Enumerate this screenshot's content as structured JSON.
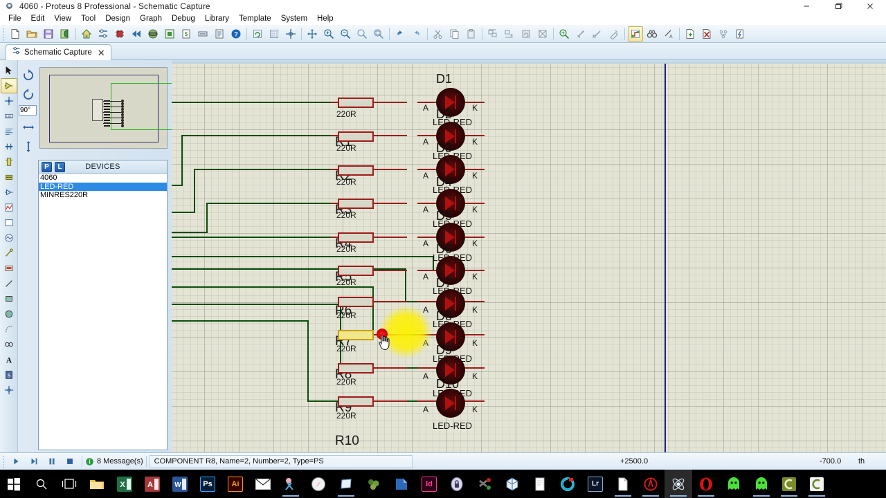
{
  "window": {
    "title": "4060 - Proteus 8 Professional - Schematic Capture",
    "app_icon": "proteus-icon",
    "minimize_label": "—",
    "maximize_label": "❐",
    "close_label": "✕"
  },
  "menubar": {
    "items": [
      {
        "label": "File"
      },
      {
        "label": "Edit"
      },
      {
        "label": "View"
      },
      {
        "label": "Tool"
      },
      {
        "label": "Design"
      },
      {
        "label": "Graph"
      },
      {
        "label": "Debug"
      },
      {
        "label": "Library"
      },
      {
        "label": "Template"
      },
      {
        "label": "System"
      },
      {
        "label": "Help"
      }
    ]
  },
  "toolbar": {
    "groups": [
      {
        "name": "file",
        "buttons": [
          {
            "name": "new-project",
            "icon": "new-document-icon"
          },
          {
            "name": "open-project",
            "icon": "open-folder-icon"
          },
          {
            "name": "save-project",
            "icon": "save-disk-icon"
          },
          {
            "name": "import-project",
            "icon": "import-icon"
          }
        ]
      },
      {
        "name": "navigate",
        "buttons": [
          {
            "name": "home-page",
            "icon": "home-icon"
          },
          {
            "name": "schematic-capture",
            "icon": "schematic-icon"
          },
          {
            "name": "pcb-layout",
            "icon": "chip-icon"
          },
          {
            "name": "back",
            "icon": "rewind-icon"
          },
          {
            "name": "3d-visualizer",
            "icon": "3d-view-icon"
          },
          {
            "name": "source-code",
            "icon": "source-icon"
          },
          {
            "name": "bill-of-materials",
            "icon": "bom-icon"
          },
          {
            "name": "design-explorer",
            "icon": "explorer-icon"
          },
          {
            "name": "report",
            "icon": "report-icon"
          },
          {
            "name": "help",
            "icon": "help-question-icon"
          }
        ]
      },
      {
        "name": "view",
        "buttons": [
          {
            "name": "refresh-display",
            "icon": "refresh-icon"
          },
          {
            "name": "toggle-grid",
            "icon": "grid-icon"
          },
          {
            "name": "origin",
            "icon": "crosshair-icon"
          },
          {
            "name": "pan",
            "icon": "pan-arrows-icon"
          },
          {
            "name": "zoom-in",
            "icon": "zoom-in-icon"
          },
          {
            "name": "zoom-out",
            "icon": "zoom-out-icon"
          },
          {
            "name": "zoom-all",
            "icon": "zoom-all-icon"
          },
          {
            "name": "zoom-area",
            "icon": "zoom-area-icon"
          }
        ]
      },
      {
        "name": "edit",
        "buttons": [
          {
            "name": "undo",
            "icon": "undo-arrow-icon"
          },
          {
            "name": "redo",
            "icon": "redo-arrow-icon"
          },
          {
            "name": "cut",
            "icon": "scissors-icon"
          },
          {
            "name": "copy",
            "icon": "copy-icon"
          },
          {
            "name": "paste",
            "icon": "paste-icon"
          },
          {
            "name": "block-copy",
            "icon": "block-copy-icon"
          },
          {
            "name": "block-move",
            "icon": "block-move-icon"
          },
          {
            "name": "block-rotate",
            "icon": "block-rotate-icon"
          },
          {
            "name": "block-delete",
            "icon": "block-delete-icon"
          },
          {
            "name": "pick-device",
            "icon": "pick-device-icon"
          },
          {
            "name": "make-device",
            "icon": "make-device-icon"
          },
          {
            "name": "packaging-tool",
            "icon": "packaging-icon"
          },
          {
            "name": "decompose",
            "icon": "decompose-icon"
          }
        ]
      },
      {
        "name": "tools",
        "buttons": [
          {
            "name": "wire-autorouter",
            "icon": "autoroute-icon",
            "active": true
          },
          {
            "name": "search-and-tag",
            "icon": "binoculars-icon"
          },
          {
            "name": "property-assignment",
            "icon": "property-icon"
          },
          {
            "name": "new-sheet",
            "icon": "new-sheet-icon"
          },
          {
            "name": "remove-sheet",
            "icon": "remove-sheet-icon"
          },
          {
            "name": "goto-sheet",
            "icon": "goto-sheet-icon"
          },
          {
            "name": "design-explorer-2",
            "icon": "exit-sheet-icon"
          }
        ]
      }
    ]
  },
  "document_tab": {
    "label": "Schematic Capture",
    "icon": "schematic-icon",
    "close_label": "✕"
  },
  "toolrail": {
    "items": [
      {
        "name": "selection-mode",
        "icon": "arrow-pointer-icon",
        "selected": false
      },
      {
        "name": "component-mode",
        "icon": "component-icon",
        "selected": true
      },
      {
        "name": "junction-dot-mode",
        "icon": "junction-dot-icon",
        "selected": false
      },
      {
        "name": "wire-label-mode",
        "icon": "label-lbl-icon",
        "selected": false
      },
      {
        "name": "text-script-mode",
        "icon": "text-script-icon",
        "selected": false
      },
      {
        "name": "buses-mode",
        "icon": "bus-icon",
        "selected": false
      },
      {
        "name": "subcircuit-mode",
        "icon": "subcircuit-icon",
        "selected": false
      },
      {
        "name": "terminals-mode",
        "icon": "terminal-icon",
        "selected": false
      },
      {
        "name": "device-pins-mode",
        "icon": "device-pin-icon",
        "selected": false
      },
      {
        "name": "graph-mode",
        "icon": "graph-icon",
        "selected": false
      },
      {
        "name": "tape-recorder-mode",
        "icon": "tape-recorder-icon",
        "selected": false
      },
      {
        "name": "generator-mode",
        "icon": "generator-icon",
        "selected": false
      },
      {
        "name": "voltage-probe-mode",
        "icon": "probe-icon",
        "selected": false
      },
      {
        "name": "virtual-instruments-mode",
        "icon": "instrument-icon",
        "selected": false
      },
      {
        "name": "2d-line-mode",
        "icon": "line-icon",
        "selected": false
      },
      {
        "name": "2d-box-mode",
        "icon": "rectangle-icon",
        "selected": false
      },
      {
        "name": "2d-circle-mode",
        "icon": "circle-icon",
        "selected": false
      },
      {
        "name": "2d-arc-mode",
        "icon": "arc-icon",
        "selected": false
      },
      {
        "name": "2d-path-mode",
        "icon": "path-icon",
        "selected": false
      },
      {
        "name": "2d-text-mode",
        "icon": "text-a-icon",
        "selected": false
      },
      {
        "name": "2d-symbol-mode",
        "icon": "symbol-icon",
        "selected": false
      },
      {
        "name": "2d-marker-mode",
        "icon": "marker-crosshair-icon",
        "selected": false
      }
    ]
  },
  "orientation": {
    "rotate_cw": "rotate-clockwise-icon",
    "rotate_ccw": "rotate-counterclockwise-icon",
    "angle_value": "90°",
    "mirror_x": "mirror-horizontal-icon",
    "mirror_y": "mirror-vertical-icon"
  },
  "devices_panel": {
    "p_button": "P",
    "l_button": "L",
    "title": "DEVICES",
    "items": [
      {
        "label": "4060",
        "selected": false
      },
      {
        "label": "LED-RED",
        "selected": true
      },
      {
        "label": "MINRES220R",
        "selected": false
      }
    ]
  },
  "schematic": {
    "components": [
      {
        "ref": "R1",
        "value": "220R",
        "type": "resistor",
        "highlighted": false
      },
      {
        "ref": "R2",
        "value": "220R",
        "type": "resistor",
        "highlighted": false
      },
      {
        "ref": "R3",
        "value": "220R",
        "type": "resistor",
        "highlighted": false
      },
      {
        "ref": "R4",
        "value": "220R",
        "type": "resistor",
        "highlighted": false
      },
      {
        "ref": "R5",
        "value": "220R",
        "type": "resistor",
        "highlighted": false
      },
      {
        "ref": "R6",
        "value": "220R",
        "type": "resistor",
        "highlighted": false
      },
      {
        "ref": "R7",
        "value": "220R",
        "type": "resistor",
        "highlighted": false
      },
      {
        "ref": "R8",
        "value": "220R",
        "type": "resistor",
        "highlighted": true
      },
      {
        "ref": "R9",
        "value": "220R",
        "type": "resistor",
        "highlighted": false
      },
      {
        "ref": "R10",
        "value": "220R",
        "type": "resistor",
        "highlighted": false
      }
    ],
    "leds": [
      {
        "ref": "D1",
        "value": "LED-RED",
        "anode": "A",
        "cathode": "K"
      },
      {
        "ref": "D2",
        "value": "LED-RED",
        "anode": "A",
        "cathode": "K"
      },
      {
        "ref": "D3",
        "value": "LED-RED",
        "anode": "A",
        "cathode": "K"
      },
      {
        "ref": "D4",
        "value": "LED-RED",
        "anode": "A",
        "cathode": "K"
      },
      {
        "ref": "D5",
        "value": "LED-RED",
        "anode": "A",
        "cathode": "K"
      },
      {
        "ref": "D6",
        "value": "LED-RED",
        "anode": "A",
        "cathode": "K"
      },
      {
        "ref": "D7",
        "value": "LED-RED",
        "anode": "A",
        "cathode": "K"
      },
      {
        "ref": "D8",
        "value": "LED-RED",
        "anode": "A",
        "cathode": "K"
      },
      {
        "ref": "D9",
        "value": "LED-RED",
        "anode": "A",
        "cathode": "K"
      },
      {
        "ref": "D10",
        "value": "LED-RED",
        "anode": "A",
        "cathode": "K"
      }
    ],
    "colors": {
      "wire": "#0d4d0d",
      "lead": "#9c1c1c",
      "resistor_body": "#d8d8c8",
      "resistor_highlight": "#f0e68c",
      "sheet_border": "#1b1b8f",
      "canvas": "#e4e4d5"
    },
    "cursor": {
      "icon": "hand-pointer-icon",
      "highlight": "click-highlight"
    }
  },
  "statusbar": {
    "controls": [
      {
        "name": "play-simulation",
        "icon": "play-icon"
      },
      {
        "name": "step-simulation",
        "icon": "step-icon"
      },
      {
        "name": "pause-simulation",
        "icon": "pause-icon"
      },
      {
        "name": "stop-simulation",
        "icon": "stop-icon"
      }
    ],
    "messages": "8 Message(s)",
    "message_icon": "info-icon",
    "selection_info": "COMPONENT R8, Name=2, Number=2, Type=PS",
    "coord_x": "+2500.0",
    "coord_y": "-700.0",
    "coord_units": "th"
  },
  "taskbar": {
    "items": [
      {
        "name": "start-button",
        "icon": "windows-logo-icon",
        "label": "",
        "active": false
      },
      {
        "name": "search-button",
        "icon": "search-magnifier-icon",
        "label": "",
        "active": false
      },
      {
        "name": "task-view-button",
        "icon": "task-view-icon",
        "label": "",
        "active": false
      },
      {
        "name": "file-explorer",
        "icon": "folder-icon",
        "label": "",
        "active": false
      },
      {
        "name": "excel",
        "icon": "excel-icon",
        "label": "X",
        "active": false
      },
      {
        "name": "access",
        "icon": "access-icon",
        "label": "A",
        "active": false
      },
      {
        "name": "word",
        "icon": "word-icon",
        "label": "W",
        "active": false
      },
      {
        "name": "photoshop",
        "icon": "photoshop-icon",
        "label": "Ps",
        "active": false
      },
      {
        "name": "illustrator",
        "icon": "illustrator-icon",
        "label": "Ai",
        "active": false
      },
      {
        "name": "mail",
        "icon": "mail-envelope-icon",
        "label": "",
        "active": false
      },
      {
        "name": "snipping-tool",
        "icon": "snipping-tool-icon",
        "label": "",
        "active": false,
        "running": true
      },
      {
        "name": "compass-app",
        "icon": "compass-icon",
        "label": "",
        "active": false
      },
      {
        "name": "sticky-notes",
        "icon": "sticky-notes-icon",
        "label": "",
        "active": false,
        "running": true
      },
      {
        "name": "nature-app",
        "icon": "plant-icon",
        "label": "",
        "active": false
      },
      {
        "name": "blue-app",
        "icon": "blue-doc-icon",
        "label": "",
        "active": false
      },
      {
        "name": "indesign",
        "icon": "indesign-icon",
        "label": "Id",
        "active": false
      },
      {
        "name": "security-app",
        "icon": "lock-icon",
        "label": "",
        "active": false
      },
      {
        "name": "pix-app",
        "icon": "pix-icon",
        "label": "",
        "active": false
      },
      {
        "name": "cube-app",
        "icon": "cube-icon",
        "label": "",
        "active": false
      },
      {
        "name": "notes-app",
        "icon": "notebook-icon",
        "label": "",
        "active": false
      },
      {
        "name": "circle-app",
        "icon": "circle-c-icon",
        "label": "",
        "active": false
      },
      {
        "name": "lightroom",
        "icon": "lightroom-icon",
        "label": "Lr",
        "active": false
      },
      {
        "name": "document-app",
        "icon": "document-icon",
        "label": "",
        "active": false,
        "running": true
      },
      {
        "name": "red-circle-app",
        "icon": "red-circle-icon",
        "label": "",
        "active": false,
        "running": true
      },
      {
        "name": "proteus-app",
        "icon": "proteus-atom-icon",
        "label": "",
        "active": true,
        "running": true
      },
      {
        "name": "opera-browser",
        "icon": "opera-o-icon",
        "label": "",
        "active": false,
        "running": true
      },
      {
        "name": "green-ghost-1",
        "icon": "ghost-icon",
        "label": "",
        "active": false
      },
      {
        "name": "green-ghost-2",
        "icon": "ghost-icon",
        "label": "",
        "active": false,
        "running": true
      },
      {
        "name": "olive-c-app",
        "icon": "c-bracket-icon",
        "label": "",
        "active": false,
        "running": true
      },
      {
        "name": "white-c-app",
        "icon": "c-bracket-icon",
        "label": "",
        "active": false,
        "running": true
      }
    ]
  }
}
